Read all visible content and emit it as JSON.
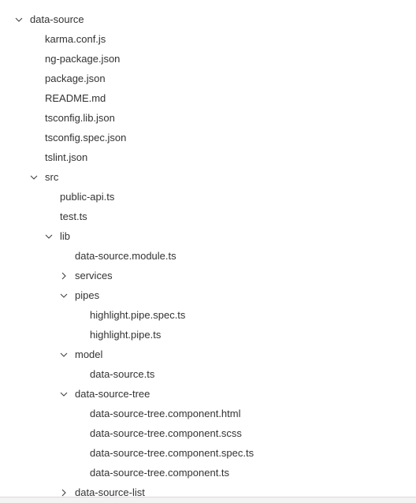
{
  "explorer": {
    "items": [
      {
        "label": "data-source",
        "depth": 0,
        "kind": "folder",
        "expanded": true
      },
      {
        "label": "karma.conf.js",
        "depth": 1,
        "kind": "file"
      },
      {
        "label": "ng-package.json",
        "depth": 1,
        "kind": "file"
      },
      {
        "label": "package.json",
        "depth": 1,
        "kind": "file"
      },
      {
        "label": "README.md",
        "depth": 1,
        "kind": "file"
      },
      {
        "label": "tsconfig.lib.json",
        "depth": 1,
        "kind": "file"
      },
      {
        "label": "tsconfig.spec.json",
        "depth": 1,
        "kind": "file"
      },
      {
        "label": "tslint.json",
        "depth": 1,
        "kind": "file"
      },
      {
        "label": "src",
        "depth": 1,
        "kind": "folder",
        "expanded": true
      },
      {
        "label": "public-api.ts",
        "depth": 2,
        "kind": "file"
      },
      {
        "label": "test.ts",
        "depth": 2,
        "kind": "file"
      },
      {
        "label": "lib",
        "depth": 2,
        "kind": "folder",
        "expanded": true
      },
      {
        "label": "data-source.module.ts",
        "depth": 3,
        "kind": "file"
      },
      {
        "label": "services",
        "depth": 3,
        "kind": "folder",
        "expanded": false
      },
      {
        "label": "pipes",
        "depth": 3,
        "kind": "folder",
        "expanded": true
      },
      {
        "label": "highlight.pipe.spec.ts",
        "depth": 4,
        "kind": "file"
      },
      {
        "label": "highlight.pipe.ts",
        "depth": 4,
        "kind": "file"
      },
      {
        "label": "model",
        "depth": 3,
        "kind": "folder",
        "expanded": true
      },
      {
        "label": "data-source.ts",
        "depth": 4,
        "kind": "file"
      },
      {
        "label": "data-source-tree",
        "depth": 3,
        "kind": "folder",
        "expanded": true
      },
      {
        "label": "data-source-tree.component.html",
        "depth": 4,
        "kind": "file"
      },
      {
        "label": "data-source-tree.component.scss",
        "depth": 4,
        "kind": "file"
      },
      {
        "label": "data-source-tree.component.spec.ts",
        "depth": 4,
        "kind": "file"
      },
      {
        "label": "data-source-tree.component.ts",
        "depth": 4,
        "kind": "file"
      },
      {
        "label": "data-source-list",
        "depth": 3,
        "kind": "folder",
        "expanded": false
      }
    ]
  },
  "icons": {
    "expanded": "chevron-down-icon",
    "collapsed": "chevron-right-icon"
  },
  "colors": {
    "text": "#333333",
    "chevron": "#424242",
    "background": "#ffffff"
  }
}
